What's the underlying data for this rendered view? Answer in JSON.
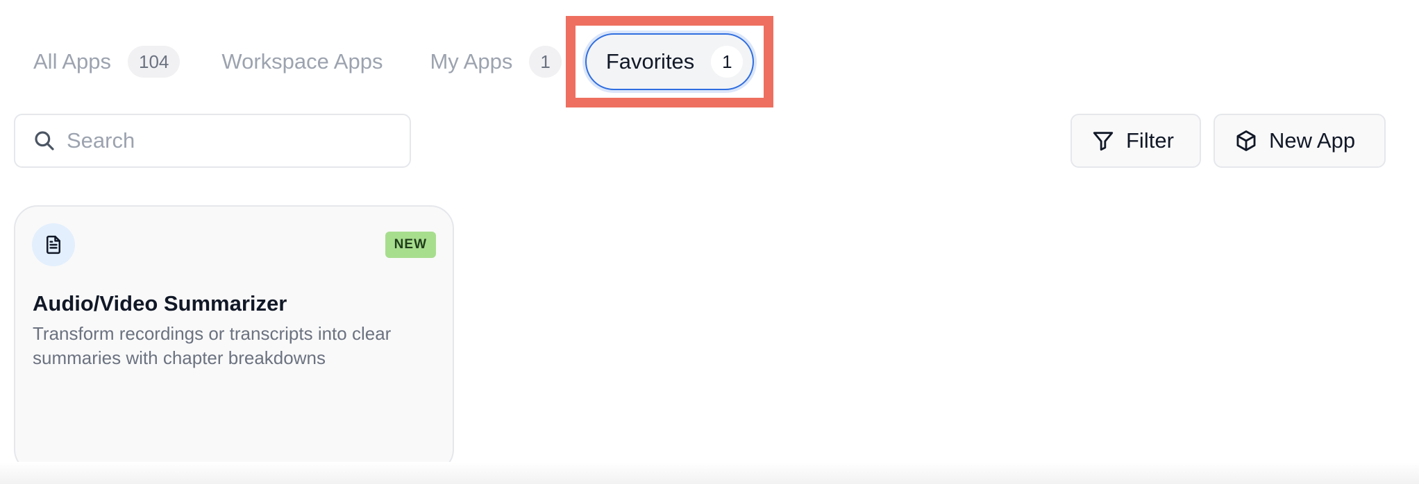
{
  "tabs": [
    {
      "label": "All Apps",
      "count": "104"
    },
    {
      "label": "Workspace Apps"
    },
    {
      "label": "My Apps",
      "count": "1"
    },
    {
      "label": "Favorites",
      "count": "1",
      "selected": true
    }
  ],
  "search": {
    "placeholder": "Search",
    "value": "",
    "icon": "search-icon"
  },
  "toolbar": {
    "filter_label": "Filter",
    "filter_icon": "filter-icon",
    "new_app_label": "New App",
    "new_app_icon": "cube-icon"
  },
  "cards": [
    {
      "icon": "document-icon",
      "badge": "NEW",
      "title": "Audio/Video Summarizer",
      "description": "Transform recordings or transcripts into clear summaries with chapter breakdowns"
    }
  ],
  "colors": {
    "accent": "#2f6ee0",
    "highlight": "#ee6f5f",
    "badge_bg": "#a7de8e",
    "muted_text": "#9ca3af"
  }
}
